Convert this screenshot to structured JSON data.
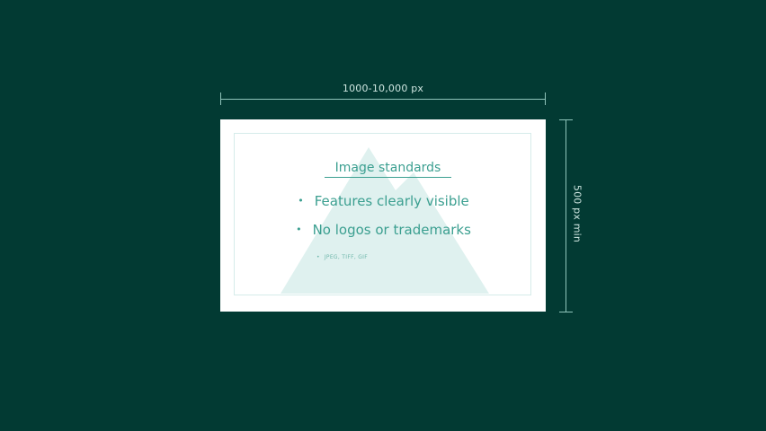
{
  "dimensions": {
    "width_label": "1000-10,000 px",
    "height_label": "500 px min"
  },
  "card": {
    "title": "Image standards",
    "bullets": [
      "Features clearly visible",
      "No logos or trademarks"
    ],
    "small_bullet": "JPEG, TIFF, GIF",
    "bullet_glyph": "•",
    "graphic_icon": "mountain-icon"
  },
  "colors": {
    "background": "#023a33",
    "dimension_line": "#8fc4ba",
    "card": "#ffffff",
    "accent_text": "#3b9f90",
    "mountain_fill": "#dff1ef"
  }
}
